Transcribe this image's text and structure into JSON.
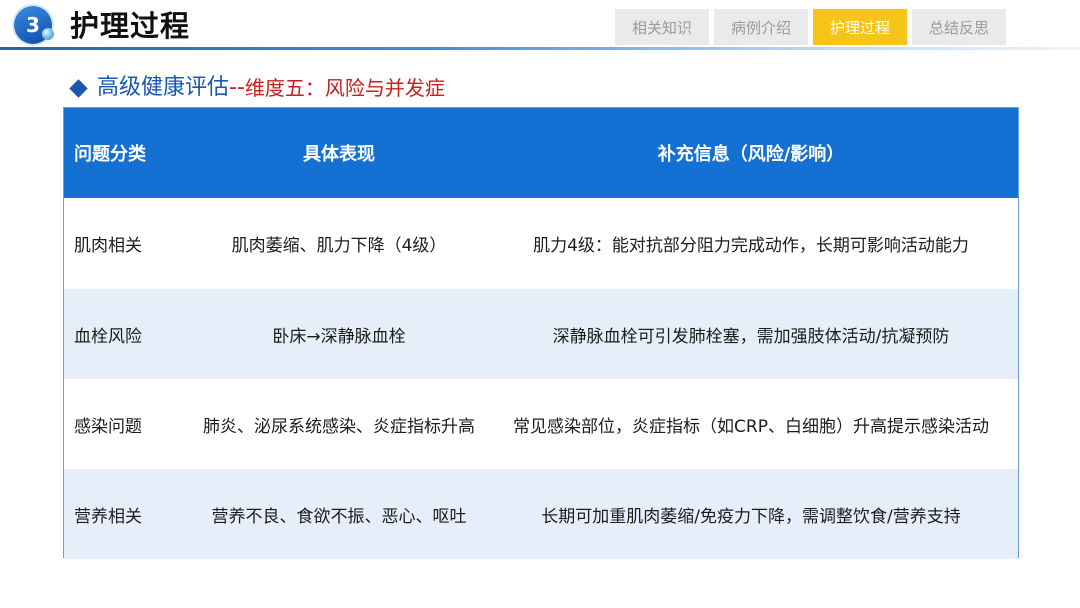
{
  "header": {
    "section_number": "3",
    "title": "护理过程",
    "tabs": [
      {
        "label": "相关知识",
        "active": false
      },
      {
        "label": "病例介绍",
        "active": false
      },
      {
        "label": "护理过程",
        "active": true
      },
      {
        "label": "总结反思",
        "active": false
      }
    ]
  },
  "subtitle": {
    "main": "高级健康评估",
    "separator": "--",
    "dimension": "维度五：风险与并发症"
  },
  "table": {
    "headers": [
      "问题分类",
      "具体表现",
      "补充信息（风险/影响）"
    ],
    "rows": [
      [
        "肌肉相关",
        "肌肉萎缩、肌力下降（4级）",
        "肌力4级：能对抗部分阻力完成动作，长期可影响活动能力"
      ],
      [
        "血栓风险",
        "卧床→深静脉血栓",
        "深静脉血栓可引发肺栓塞，需加强肢体活动/抗凝预防"
      ],
      [
        "感染问题",
        "肺炎、泌尿系统感染、炎症指标升高",
        "常见感染部位，炎症指标（如CRP、白细胞）升高提示感染活动"
      ],
      [
        "营养相关",
        "营养不良、食欲不振、恶心、呕吐",
        "长期可加重肌肉萎缩/免疫力下降，需调整饮食/营养支持"
      ]
    ]
  },
  "colors": {
    "header_blue": "#1570d4",
    "row_alt": "#e6eff9",
    "tab_active": "#f7c419",
    "tab_inactive": "#eaeaea",
    "subtitle_blue": "#1a57b3",
    "subtitle_red": "#c81e1e"
  }
}
